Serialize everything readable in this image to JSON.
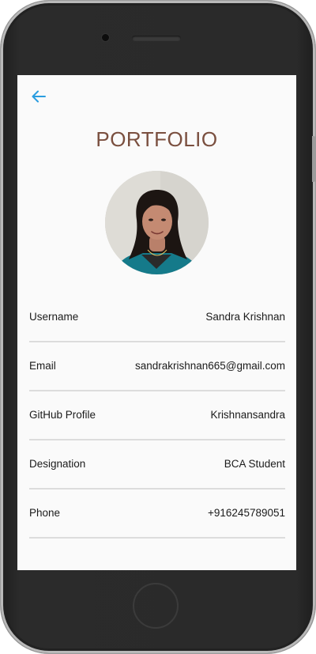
{
  "page": {
    "title": "PORTFOLIO"
  },
  "colors": {
    "title": "#7a4f3f",
    "back_icon": "#2a9de0",
    "divider": "#dcdcdc"
  },
  "icons": {
    "back": "arrow-left-icon"
  },
  "fields": [
    {
      "label": "Username",
      "value": "Sandra Krishnan"
    },
    {
      "label": "Email",
      "value": "sandrakrishnan665@gmail.com"
    },
    {
      "label": "GitHub Profile",
      "value": "Krishnansandra"
    },
    {
      "label": "Designation",
      "value": "BCA Student"
    },
    {
      "label": "Phone",
      "value": "+916245789051"
    }
  ]
}
